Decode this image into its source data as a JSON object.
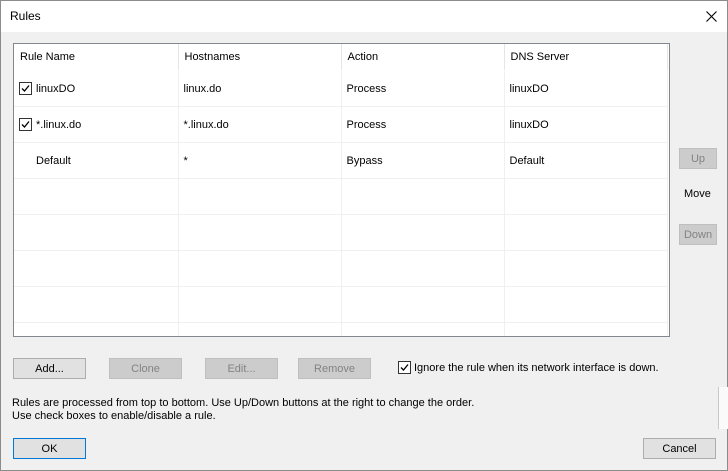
{
  "window": {
    "title": "Rules"
  },
  "table": {
    "columns": [
      "Rule Name",
      "Hostnames",
      "Action",
      "DNS Server"
    ],
    "rows": [
      {
        "checked": true,
        "name": "linuxDO",
        "hostnames": "linux.do",
        "action": "Process",
        "dns": "linuxDO"
      },
      {
        "checked": true,
        "name": "*.linux.do",
        "hostnames": "*.linux.do",
        "action": "Process",
        "dns": "linuxDO"
      },
      {
        "checked": null,
        "name": "Default",
        "hostnames": "*",
        "action": "Bypass",
        "dns": "Default"
      }
    ],
    "empty_rows": 5
  },
  "side": {
    "up": "Up",
    "move": "Move",
    "down": "Down"
  },
  "buttons": {
    "add": "Add...",
    "clone": "Clone",
    "edit": "Edit...",
    "remove": "Remove",
    "ok": "OK",
    "cancel": "Cancel"
  },
  "options": {
    "ignore_label": "Ignore the rule when its network interface is down.",
    "ignore_checked": true
  },
  "info": {
    "line1": "Rules are processed from top to bottom. Use Up/Down buttons at the right to change the order.",
    "line2": "Use check boxes to enable/disable a rule."
  }
}
